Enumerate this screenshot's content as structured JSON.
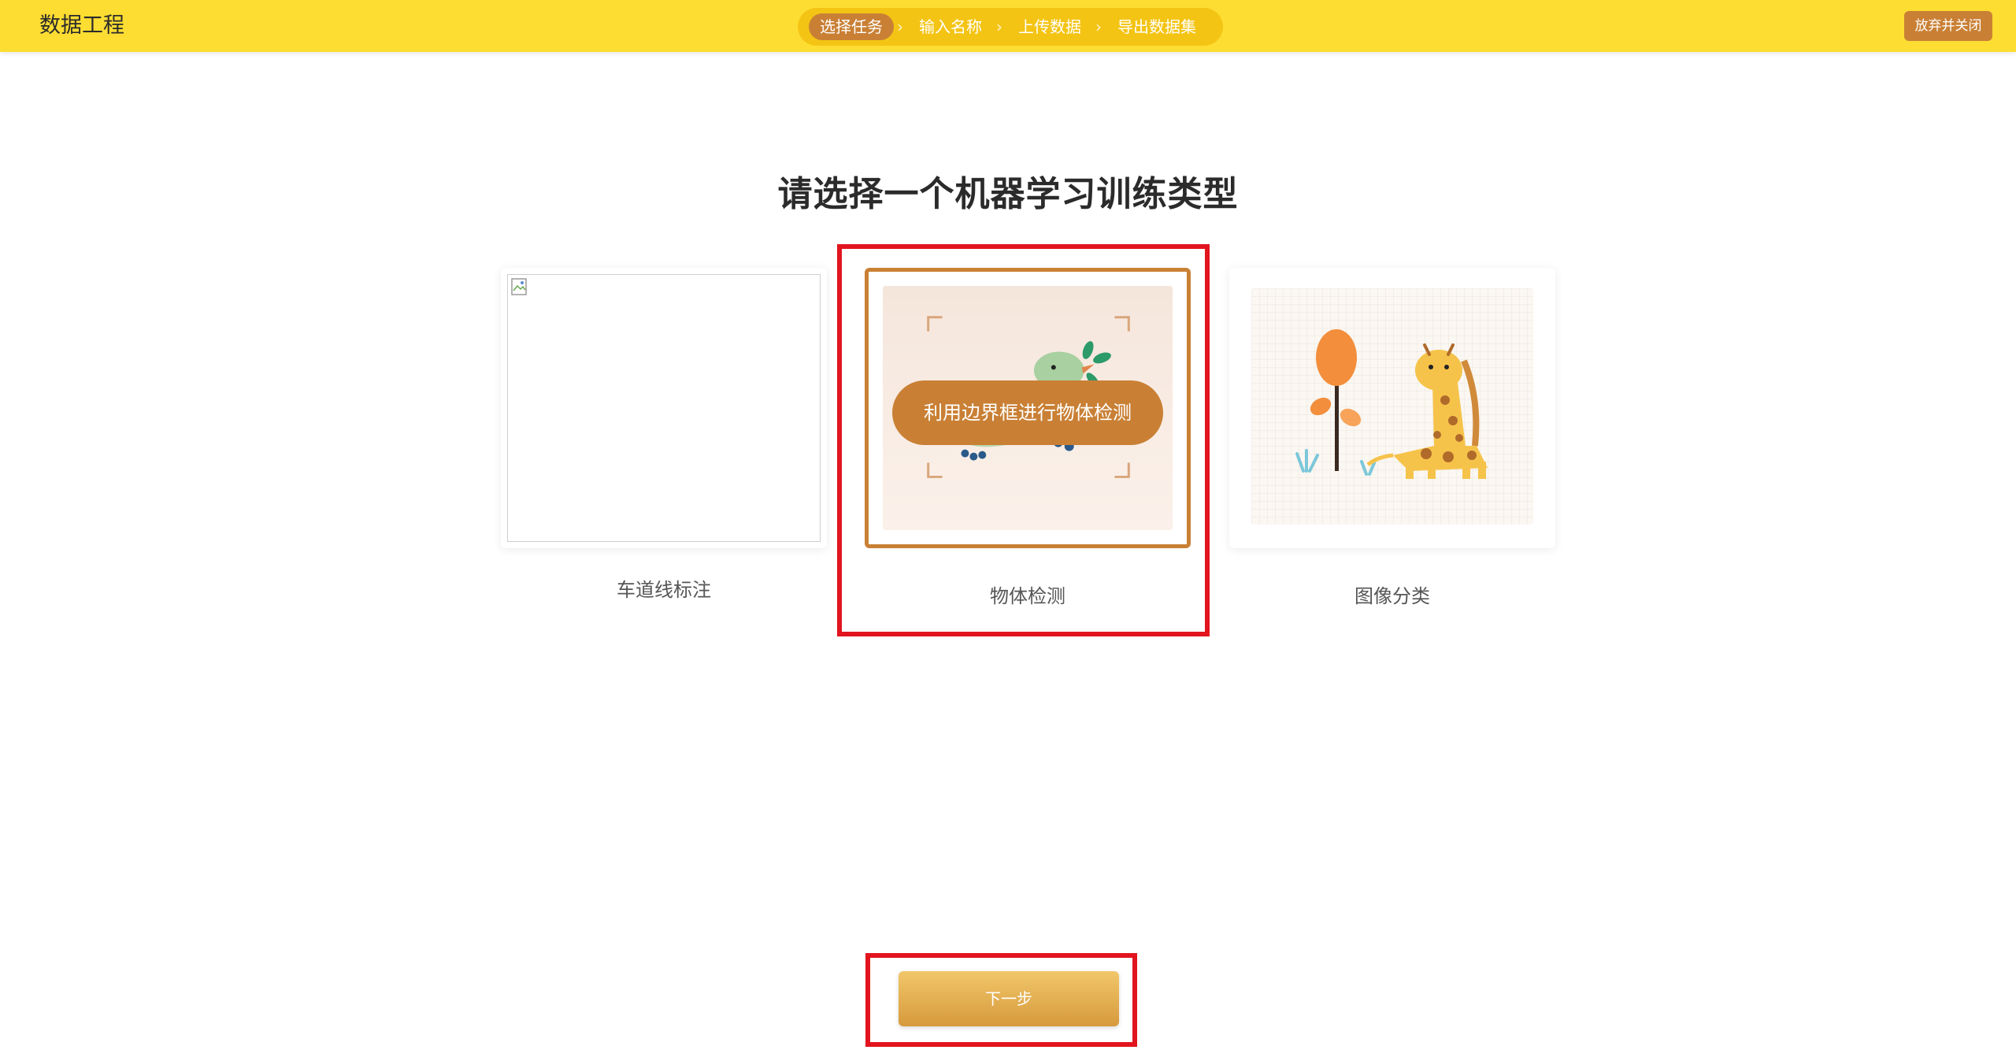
{
  "header": {
    "app_title": "数据工程",
    "steps": [
      {
        "label": "选择任务",
        "active": true
      },
      {
        "label": "输入名称",
        "active": false
      },
      {
        "label": "上传数据",
        "active": false
      },
      {
        "label": "导出数据集",
        "active": false
      }
    ],
    "step_separator": "›",
    "close_label": "放弃并关闭"
  },
  "main": {
    "heading": "请选择一个机器学习训练类型",
    "cards": [
      {
        "title": "车道线标注",
        "selected": false
      },
      {
        "title": "物体检测",
        "selected": true,
        "hover_text": "利用边界框进行物体检测"
      },
      {
        "title": "图像分类",
        "selected": false
      }
    ],
    "next_label": "下一步"
  },
  "colors": {
    "header_bg": "#fddd32",
    "stepper_bg": "#f4c414",
    "accent": "#c98035",
    "highlight": "#e2141e"
  }
}
